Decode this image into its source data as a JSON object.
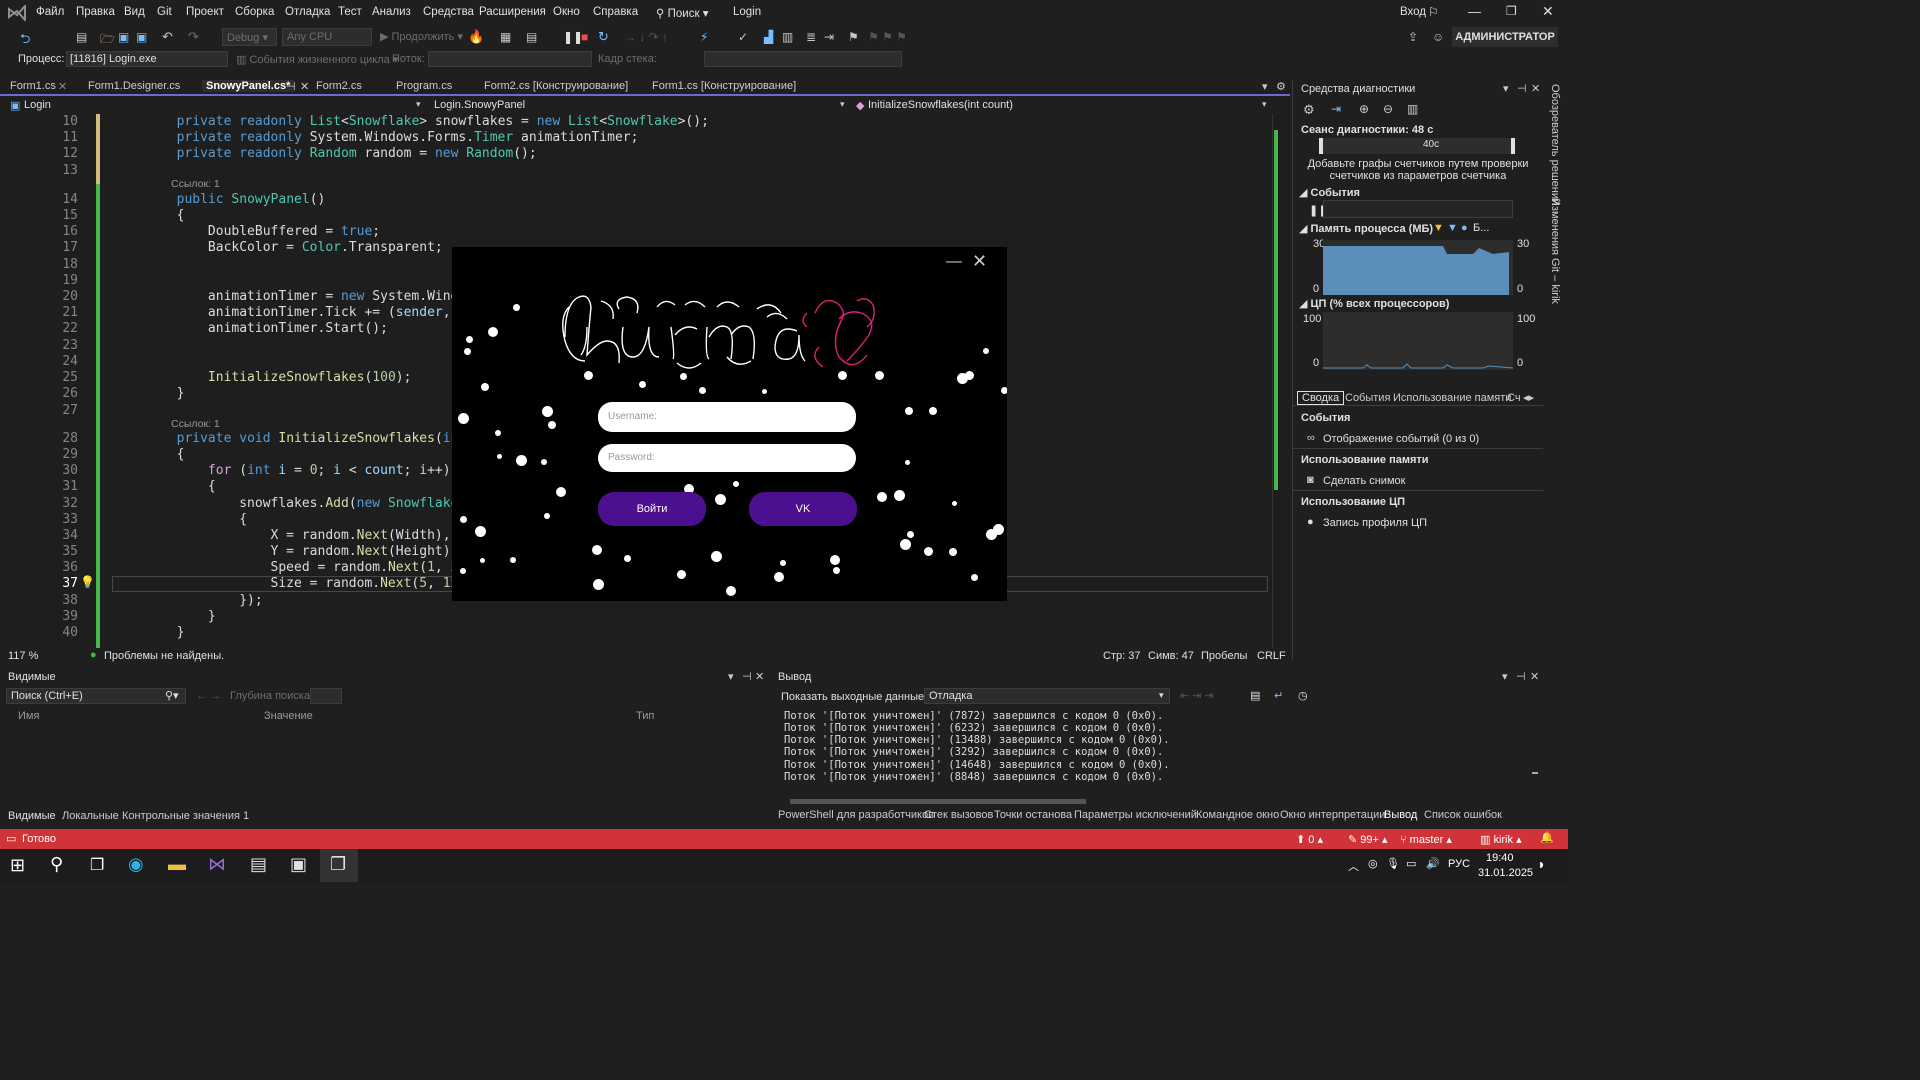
{
  "menu": [
    "Файл",
    "Правка",
    "Вид",
    "Git",
    "Проект",
    "Сборка",
    "Отладка",
    "Тест",
    "Анализ",
    "Средства",
    "Расширения",
    "Окно",
    "Справка"
  ],
  "search_label": "Поиск",
  "solution_name": "Login",
  "account": "Вход",
  "admin_badge": "АДМИНИСТРАТОР",
  "toolbar": {
    "config": "Debug",
    "platform": "Any CPU",
    "continue": "Продолжить",
    "process_label": "Процесс:",
    "process_value": "[11816] Login.exe",
    "lifecycle_events": "События жизненного цикла",
    "thread_label": "Поток:",
    "stack_label": "Кадр стека:"
  },
  "tabs": [
    "Form1.cs",
    "Form1.Designer.cs",
    "SnowyPanel.cs*",
    "Form2.cs",
    "Program.cs",
    "Form2.cs [Конструирование]",
    "Form1.cs [Конструирование]"
  ],
  "nav": {
    "project": "Login",
    "class": "Login.SnowyPanel",
    "member": "InitializeSnowflakes(int count)"
  },
  "code": {
    "l10": "10",
    "l11": "11",
    "l12": "12",
    "l13": "13",
    "l14": "14",
    "l15": "15",
    "l16": "16",
    "l17": "17",
    "l18": "18",
    "l19": "19",
    "l20": "20",
    "l21": "21",
    "l22": "22",
    "l23": "23",
    "l24": "24",
    "l25": "25",
    "l26": "26",
    "l27": "27",
    "l28": "28",
    "l29": "29",
    "l30": "30",
    "l31": "31",
    "l32": "32",
    "l33": "33",
    "l34": "34",
    "l35": "35",
    "l36": "36",
    "l37": "37",
    "l38": "38",
    "l39": "39",
    "l40": "40",
    "refs1": "Ссылок: 1",
    "refs2": "Ссылок: 1"
  },
  "editor_status": {
    "zoom": "117 %",
    "problems": "Проблемы не найдены.",
    "line": "Стр: 37",
    "col": "Симв: 47",
    "spaces": "Пробелы",
    "eol": "CRLF"
  },
  "diagnostics": {
    "title": "Средства диагностики",
    "session": "Сеанс диагностики: 48 с",
    "timeline_label": "40с",
    "hint": "Добавьте графы счетчиков путем проверки счетчиков из параметров счетчика",
    "events_header": "События",
    "memory_header": "Память процесса (МБ)",
    "memory_legend": "Б...",
    "mem_max": "30",
    "mem_min": "0",
    "mem_max_r": "30",
    "mem_min_r": "0",
    "cpu_header": "ЦП (% всех процессоров)",
    "cpu_max": "100",
    "cpu_min": "0",
    "cpu_max_r": "100",
    "cpu_min_r": "0",
    "tabs": [
      "Сводка",
      "События",
      "Использование памяти",
      "Сч"
    ],
    "sec_events": "События",
    "show_events": "Отображение событий (0 из 0)",
    "sec_memory": "Использование памяти",
    "snapshot": "Сделать снимок",
    "sec_cpu": "Использование ЦП",
    "cpu_profile": "Запись профиля ЦП"
  },
  "right_sidebar": [
    "Обозреватель решений",
    "Изменения Git – kirik"
  ],
  "locals": {
    "title": "Видимые",
    "search_placeholder": "Поиск (Ctrl+E)",
    "depth_label": "Глубина поиска:",
    "col_name": "Имя",
    "col_value": "Значение",
    "col_type": "Тип",
    "tabs": [
      "Видимые",
      "Локальные",
      "Контрольные значения 1"
    ]
  },
  "output": {
    "title": "Вывод",
    "show_from": "Показать выходные данные из:",
    "source": "Отладка",
    "lines": [
      "Поток '[Поток уничтожен]' (7872) завершился с кодом 0 (0x0).",
      "Поток '[Поток уничтожен]' (6232) завершился с кодом 0 (0x0).",
      "Поток '[Поток уничтожен]' (13488) завершился с кодом 0 (0x0).",
      "Поток '[Поток уничтожен]' (3292) завершился с кодом 0 (0x0).",
      "Поток '[Поток уничтожен]' (14648) завершился с кодом 0 (0x0).",
      "Поток '[Поток уничтожен]' (8848) завершился с кодом 0 (0x0)."
    ],
    "tabs": [
      "PowerShell для разработчиков",
      "Стек вызовов",
      "Точки останова",
      "Параметры исключений",
      "Командное окно",
      "Окно интерпретации",
      "Вывод",
      "Список ошибок"
    ]
  },
  "status": {
    "ready": "Готово",
    "errors": "0",
    "changes": "99+",
    "branch": "master",
    "repo": "kirik"
  },
  "taskbar": {
    "lang": "РУС",
    "time": "19:40",
    "date": "31.01.2025"
  },
  "login_form": {
    "username_placeholder": "Username:",
    "password_placeholder": "Password:",
    "login_button": "Войти",
    "vk_button": "VK",
    "logo_colors": {
      "main": "#ffffff",
      "accent": "#e0207a"
    }
  }
}
